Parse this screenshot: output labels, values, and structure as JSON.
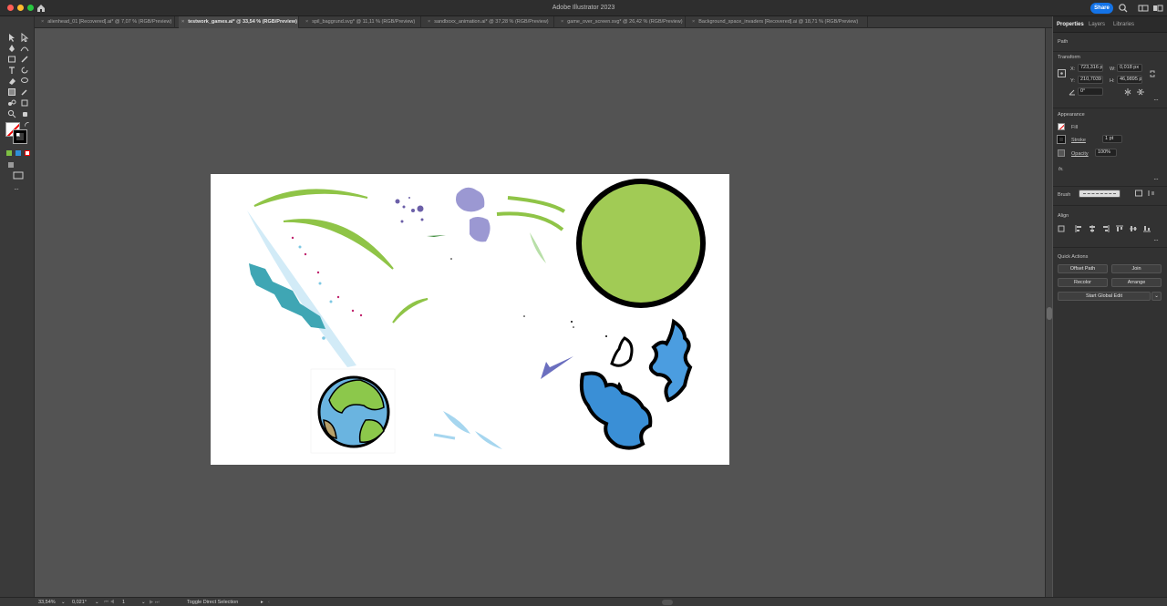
{
  "window": {
    "title": "Adobe Illustrator 2023",
    "share_label": "Share"
  },
  "tabs": [
    {
      "label": "alienhead_01 [Recovered].ai* @ 7,07 % (RGB/Preview)",
      "active": false
    },
    {
      "label": "testwork_games.ai* @ 33,54 % (RGB/Preview)",
      "active": true
    },
    {
      "label": "spil_baggrund.svg* @ 11,11 % (RGB/Preview)",
      "active": false
    },
    {
      "label": "sandboxx_animation.ai* @ 37,28 % (RGB/Preview)",
      "active": false
    },
    {
      "label": "game_over_screen.svg* @ 26,42 % (RGB/Preview)",
      "active": false
    },
    {
      "label": "Background_space_invaders [Recovered].ai @ 18,71 % (RGB/Preview)",
      "active": false
    }
  ],
  "panel": {
    "tabs": [
      "Properties",
      "Layers",
      "Libraries"
    ],
    "selection_type": "Path",
    "transform": {
      "title": "Transform",
      "x_label": "X:",
      "x_value": "723,316 p",
      "y_label": "Y:",
      "y_value": "210,7039",
      "w_label": "W:",
      "w_value": "0,018 px",
      "h_label": "H:",
      "h_value": "46,9895 p",
      "angle_value": "0°"
    },
    "appearance": {
      "title": "Appearance",
      "fill_label": "Fill",
      "stroke_label": "Stroke",
      "stroke_value": "1 pt",
      "opacity_label": "Opacity",
      "opacity_value": "100%",
      "fx_label": "fx."
    },
    "brush": {
      "title": "Brush"
    },
    "align": {
      "title": "Align"
    },
    "quick_actions": {
      "title": "Quick Actions",
      "offset_path": "Offset Path",
      "join": "Join",
      "recolor": "Recolor",
      "arrange": "Arrange",
      "start_global_edit": "Start Global Edit"
    }
  },
  "status": {
    "zoom": "33,54%",
    "rotation": "0,021°",
    "artboard_number": "1",
    "tool_hint": "Toggle Direct Selection"
  },
  "colors": {
    "accent": "#1473e6",
    "green_circle": "#a1cb55",
    "grass": "#8fc447",
    "blob_blue": "#3a8fd6"
  }
}
